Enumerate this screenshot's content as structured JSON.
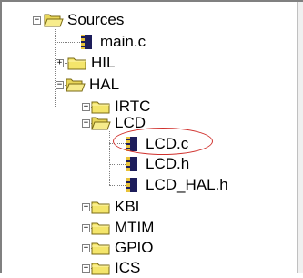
{
  "tree": {
    "root": {
      "label": "Sources",
      "expanded": true,
      "icon": "open-folder-icon"
    },
    "items": [
      {
        "label": "main.c",
        "type": "file",
        "icon": "source-file-icon"
      },
      {
        "label": "HIL",
        "type": "folder",
        "expanded": false,
        "icon": "folder-icon"
      },
      {
        "label": "HAL",
        "type": "folder",
        "expanded": true,
        "icon": "open-folder-icon"
      },
      {
        "label": "IRTC",
        "type": "folder",
        "expanded": false,
        "icon": "folder-icon"
      },
      {
        "label": "LCD",
        "type": "folder",
        "expanded": true,
        "icon": "open-folder-icon"
      },
      {
        "label": "LCD.c",
        "type": "file",
        "icon": "source-file-icon",
        "highlighted": true
      },
      {
        "label": "LCD.h",
        "type": "file",
        "icon": "header-file-icon"
      },
      {
        "label": "LCD_HAL.h",
        "type": "file",
        "icon": "header-file-icon"
      },
      {
        "label": "KBI",
        "type": "folder",
        "expanded": false,
        "icon": "folder-icon"
      },
      {
        "label": "MTIM",
        "type": "folder",
        "expanded": false,
        "icon": "folder-icon"
      },
      {
        "label": "GPIO",
        "type": "folder",
        "expanded": false,
        "icon": "folder-icon"
      },
      {
        "label": "ICS",
        "type": "folder",
        "expanded": false,
        "icon": "folder-icon"
      }
    ]
  },
  "colors": {
    "folder": "#f4e56b",
    "folder_edge": "#7a6a14",
    "file_body": "#1d1d5a",
    "file_stripe": "#e8c33a",
    "highlight_circle": "#d0312d"
  }
}
